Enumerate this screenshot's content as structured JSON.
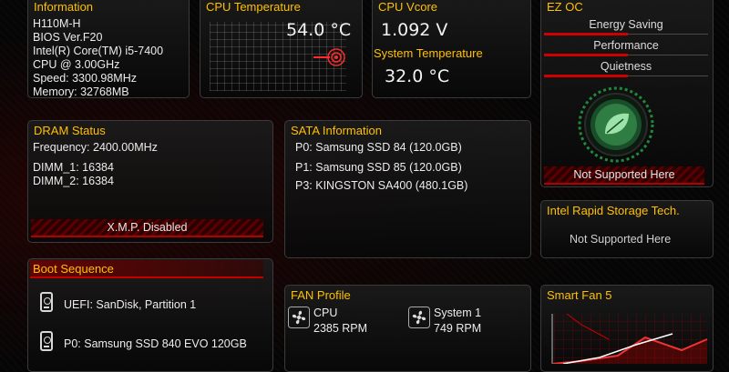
{
  "information": {
    "title": "Information",
    "lines": [
      "H110M-H",
      "BIOS Ver.F20",
      "Intel(R) Core(TM) i5-7400",
      "CPU @ 3.00GHz",
      "Speed: 3300.98MHz",
      "Memory: 32768MB"
    ]
  },
  "cpu_temp": {
    "title": "CPU Temperature",
    "value": "54.0 °C"
  },
  "cpu_vcore": {
    "title": "CPU Vcore",
    "value": "1.092 V"
  },
  "system_temp": {
    "title": "System Temperature",
    "value": "32.0 °C"
  },
  "ez_oc": {
    "title": "EZ OC",
    "options": [
      "Energy Saving",
      "Performance",
      "Quietness"
    ],
    "status": "Not Supported Here"
  },
  "dram": {
    "title": "DRAM Status",
    "frequency": "Frequency: 2400.00MHz",
    "dimm1": "DIMM_1: 16384",
    "dimm2": "DIMM_2: 16384",
    "xmp": "X.M.P.  Disabled"
  },
  "sata": {
    "title": "SATA Information",
    "ports": [
      "P0: Samsung SSD 84 (120.0GB)",
      "P1: Samsung SSD 85 (120.0GB)",
      "P3: KINGSTON SA400 (480.1GB)"
    ]
  },
  "rst": {
    "title": "Intel Rapid Storage Tech.",
    "status": "Not Supported Here"
  },
  "boot": {
    "title": "Boot Sequence",
    "items": [
      "UEFI: SanDisk, Partition 1",
      "P0: Samsung SSD 840 EVO 120GB"
    ]
  },
  "fan": {
    "title": "FAN Profile",
    "fans": [
      {
        "name": "CPU",
        "rpm": "2385 RPM"
      },
      {
        "name": "System 1",
        "rpm": "749 RPM"
      }
    ]
  },
  "smart_fan": {
    "title": "Smart Fan 5"
  },
  "colors": {
    "accent": "#ffc000",
    "red": "#d10000"
  }
}
